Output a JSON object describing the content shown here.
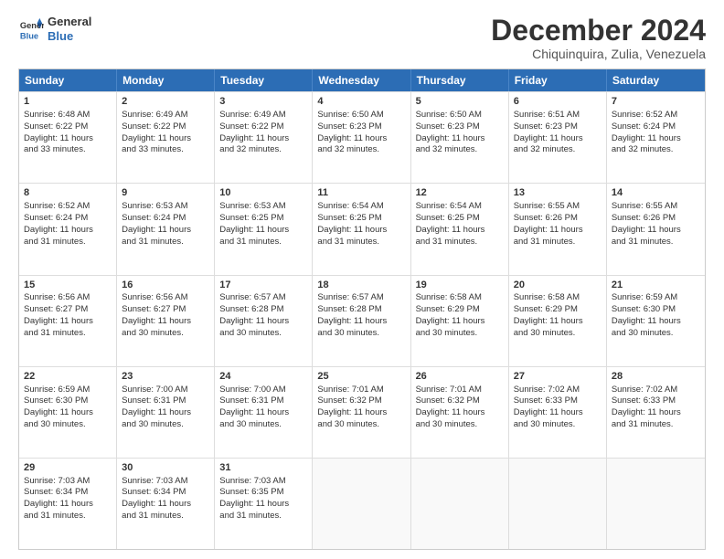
{
  "logo": {
    "line1": "General",
    "line2": "Blue"
  },
  "title": "December 2024",
  "subtitle": "Chiquinquira, Zulia, Venezuela",
  "days": [
    "Sunday",
    "Monday",
    "Tuesday",
    "Wednesday",
    "Thursday",
    "Friday",
    "Saturday"
  ],
  "weeks": [
    [
      {
        "day": "1",
        "sunrise": "6:48 AM",
        "sunset": "6:22 PM",
        "daylight": "11 hours and 33 minutes."
      },
      {
        "day": "2",
        "sunrise": "6:49 AM",
        "sunset": "6:22 PM",
        "daylight": "11 hours and 33 minutes."
      },
      {
        "day": "3",
        "sunrise": "6:49 AM",
        "sunset": "6:22 PM",
        "daylight": "11 hours and 32 minutes."
      },
      {
        "day": "4",
        "sunrise": "6:50 AM",
        "sunset": "6:23 PM",
        "daylight": "11 hours and 32 minutes."
      },
      {
        "day": "5",
        "sunrise": "6:50 AM",
        "sunset": "6:23 PM",
        "daylight": "11 hours and 32 minutes."
      },
      {
        "day": "6",
        "sunrise": "6:51 AM",
        "sunset": "6:23 PM",
        "daylight": "11 hours and 32 minutes."
      },
      {
        "day": "7",
        "sunrise": "6:52 AM",
        "sunset": "6:24 PM",
        "daylight": "11 hours and 32 minutes."
      }
    ],
    [
      {
        "day": "8",
        "sunrise": "6:52 AM",
        "sunset": "6:24 PM",
        "daylight": "11 hours and 31 minutes."
      },
      {
        "day": "9",
        "sunrise": "6:53 AM",
        "sunset": "6:24 PM",
        "daylight": "11 hours and 31 minutes."
      },
      {
        "day": "10",
        "sunrise": "6:53 AM",
        "sunset": "6:25 PM",
        "daylight": "11 hours and 31 minutes."
      },
      {
        "day": "11",
        "sunrise": "6:54 AM",
        "sunset": "6:25 PM",
        "daylight": "11 hours and 31 minutes."
      },
      {
        "day": "12",
        "sunrise": "6:54 AM",
        "sunset": "6:25 PM",
        "daylight": "11 hours and 31 minutes."
      },
      {
        "day": "13",
        "sunrise": "6:55 AM",
        "sunset": "6:26 PM",
        "daylight": "11 hours and 31 minutes."
      },
      {
        "day": "14",
        "sunrise": "6:55 AM",
        "sunset": "6:26 PM",
        "daylight": "11 hours and 31 minutes."
      }
    ],
    [
      {
        "day": "15",
        "sunrise": "6:56 AM",
        "sunset": "6:27 PM",
        "daylight": "11 hours and 31 minutes."
      },
      {
        "day": "16",
        "sunrise": "6:56 AM",
        "sunset": "6:27 PM",
        "daylight": "11 hours and 30 minutes."
      },
      {
        "day": "17",
        "sunrise": "6:57 AM",
        "sunset": "6:28 PM",
        "daylight": "11 hours and 30 minutes."
      },
      {
        "day": "18",
        "sunrise": "6:57 AM",
        "sunset": "6:28 PM",
        "daylight": "11 hours and 30 minutes."
      },
      {
        "day": "19",
        "sunrise": "6:58 AM",
        "sunset": "6:29 PM",
        "daylight": "11 hours and 30 minutes."
      },
      {
        "day": "20",
        "sunrise": "6:58 AM",
        "sunset": "6:29 PM",
        "daylight": "11 hours and 30 minutes."
      },
      {
        "day": "21",
        "sunrise": "6:59 AM",
        "sunset": "6:30 PM",
        "daylight": "11 hours and 30 minutes."
      }
    ],
    [
      {
        "day": "22",
        "sunrise": "6:59 AM",
        "sunset": "6:30 PM",
        "daylight": "11 hours and 30 minutes."
      },
      {
        "day": "23",
        "sunrise": "7:00 AM",
        "sunset": "6:31 PM",
        "daylight": "11 hours and 30 minutes."
      },
      {
        "day": "24",
        "sunrise": "7:00 AM",
        "sunset": "6:31 PM",
        "daylight": "11 hours and 30 minutes."
      },
      {
        "day": "25",
        "sunrise": "7:01 AM",
        "sunset": "6:32 PM",
        "daylight": "11 hours and 30 minutes."
      },
      {
        "day": "26",
        "sunrise": "7:01 AM",
        "sunset": "6:32 PM",
        "daylight": "11 hours and 30 minutes."
      },
      {
        "day": "27",
        "sunrise": "7:02 AM",
        "sunset": "6:33 PM",
        "daylight": "11 hours and 30 minutes."
      },
      {
        "day": "28",
        "sunrise": "7:02 AM",
        "sunset": "6:33 PM",
        "daylight": "11 hours and 31 minutes."
      }
    ],
    [
      {
        "day": "29",
        "sunrise": "7:03 AM",
        "sunset": "6:34 PM",
        "daylight": "11 hours and 31 minutes."
      },
      {
        "day": "30",
        "sunrise": "7:03 AM",
        "sunset": "6:34 PM",
        "daylight": "11 hours and 31 minutes."
      },
      {
        "day": "31",
        "sunrise": "7:03 AM",
        "sunset": "6:35 PM",
        "daylight": "11 hours and 31 minutes."
      },
      null,
      null,
      null,
      null
    ]
  ],
  "labels": {
    "sunrise": "Sunrise: ",
    "sunset": "Sunset: ",
    "daylight": "Daylight: "
  }
}
